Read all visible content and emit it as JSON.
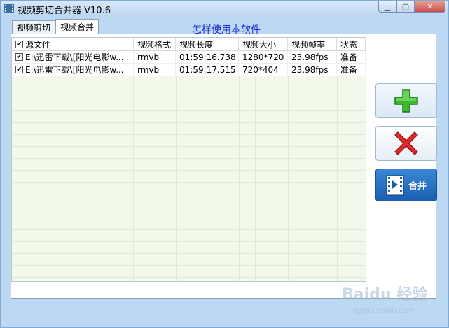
{
  "window": {
    "title": "视频剪切合并器 V10.6"
  },
  "tabs": [
    {
      "label": "视频剪切"
    },
    {
      "label": "视频合并"
    }
  ],
  "help_link": "怎样使用本软件",
  "table": {
    "columns": [
      "源文件",
      "视频格式",
      "视频长度",
      "视频大小",
      "视频帧率",
      "状态"
    ],
    "rows": [
      {
        "file": "E:\\迅雷下载\\[阳光电影w...",
        "format": "rmvb",
        "length": "01:59:16.738",
        "size": "1280*720",
        "fps": "23.98fps",
        "status": "准备"
      },
      {
        "file": "E:\\迅雷下载\\[阳光电影w...",
        "format": "rmvb",
        "length": "01:59:17.515",
        "size": "720*404",
        "fps": "23.98fps",
        "status": "准备"
      }
    ]
  },
  "buttons": {
    "merge_label": "合并"
  },
  "watermark": {
    "brand": "Baidu 经验",
    "url": "jingyan.baidu.com"
  },
  "colors": {
    "add_green": "#3cb82f",
    "delete_red": "#e12a2a",
    "merge_blue": "#1a5fb0",
    "link_blue": "#1a2fd6"
  }
}
